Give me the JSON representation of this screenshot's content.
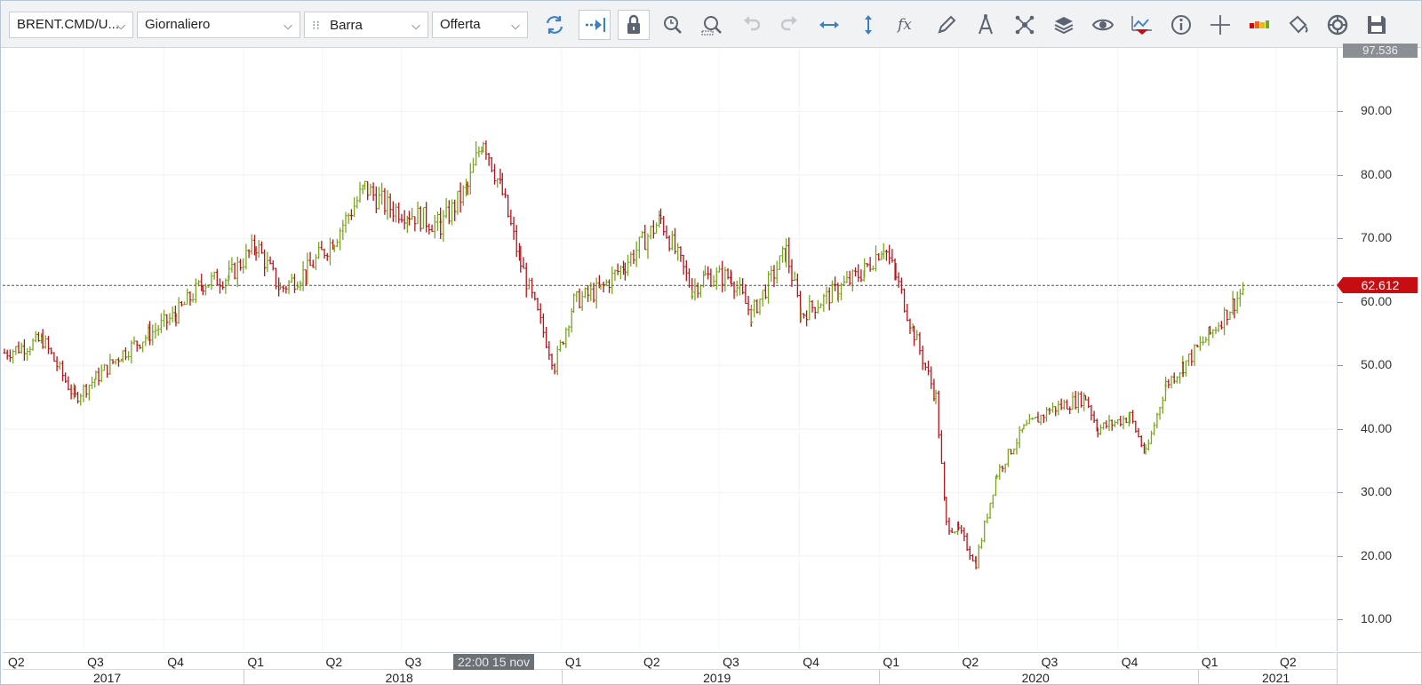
{
  "toolbar": {
    "symbol": "BRENT.CMD/U...",
    "period": "Giornaliero",
    "chart_type": "Barra",
    "price_side": "Offerta",
    "buttons": [
      "refresh-icon",
      "autoscroll-icon",
      "lock-icon",
      "zoom-time-icon",
      "zoom-area-icon",
      "undo-icon",
      "redo-icon",
      "horizontal-stretch-icon",
      "vertical-stretch-icon",
      "indicators-fx-icon",
      "pencil-draw-icon",
      "fibonacci-compass-icon",
      "network-objects-icon",
      "layers-icon",
      "visibility-eye-icon",
      "alerts-chart-icon",
      "info-icon",
      "crosshair-icon",
      "volume-colors-icon",
      "paint-bucket-icon",
      "theme-cycle-icon",
      "save-icon"
    ]
  },
  "colors": {
    "up": "#7aa61d",
    "down": "#b5121b",
    "last_price_line": "#555555",
    "last_price_tag": "#c60d12"
  },
  "axis": {
    "y_ticks": [
      "10.00",
      "20.00",
      "30.00",
      "40.00",
      "50.00",
      "60.00",
      "70.00",
      "80.00",
      "90.00"
    ],
    "y_top_label": "97.536",
    "last_price": "62.612",
    "x_quarters": [
      "Q2",
      "Q3",
      "Q4",
      "Q1",
      "Q2",
      "Q3",
      "Q1",
      "Q2",
      "Q3",
      "Q4",
      "Q1",
      "Q2",
      "Q3",
      "Q4",
      "Q1",
      "Q2"
    ],
    "x_years": [
      "2017",
      "2018",
      "2019",
      "2020",
      "2021"
    ],
    "cursor_time": "22:00 15 nov"
  },
  "chart_data": {
    "type": "line",
    "title": "",
    "instrument": "BRENT.CMD/U...",
    "ylim": [
      5,
      100
    ],
    "ylabel": "",
    "x": [
      "2017-04-01",
      "2017-05-15",
      "2017-06-21",
      "2017-07-15",
      "2017-08-15",
      "2017-09-15",
      "2017-10-15",
      "2017-11-15",
      "2017-12-15",
      "2018-01-15",
      "2018-02-12",
      "2018-03-15",
      "2018-04-15",
      "2018-05-20",
      "2018-06-15",
      "2018-07-10",
      "2018-08-15",
      "2018-09-15",
      "2018-10-03",
      "2018-10-25",
      "2018-11-15",
      "2018-12-24",
      "2019-01-15",
      "2019-02-15",
      "2019-03-15",
      "2019-04-25",
      "2019-05-31",
      "2019-06-15",
      "2019-07-15",
      "2019-08-07",
      "2019-09-16",
      "2019-10-03",
      "2019-11-15",
      "2019-12-15",
      "2020-01-06",
      "2020-01-20",
      "2020-02-10",
      "2020-03-06",
      "2020-03-18",
      "2020-04-01",
      "2020-04-21",
      "2020-05-15",
      "2020-06-15",
      "2020-07-15",
      "2020-08-25",
      "2020-09-08",
      "2020-10-15",
      "2020-11-02",
      "2020-11-25",
      "2020-12-15",
      "2021-01-15",
      "2021-02-12",
      "2021-02-25"
    ],
    "series": [
      {
        "values": [
          52,
          54,
          45,
          48,
          52,
          55,
          58,
          63,
          64,
          69,
          62,
          65,
          70,
          78,
          75,
          74,
          72,
          78,
          86,
          77,
          66,
          50,
          60,
          62,
          66,
          73,
          62,
          64,
          64,
          58,
          68,
          58,
          62,
          65,
          69,
          64,
          55,
          45,
          25,
          24,
          19,
          33,
          40,
          43,
          45,
          40,
          42,
          36,
          47,
          50,
          55,
          60,
          62.6
        ]
      }
    ]
  }
}
